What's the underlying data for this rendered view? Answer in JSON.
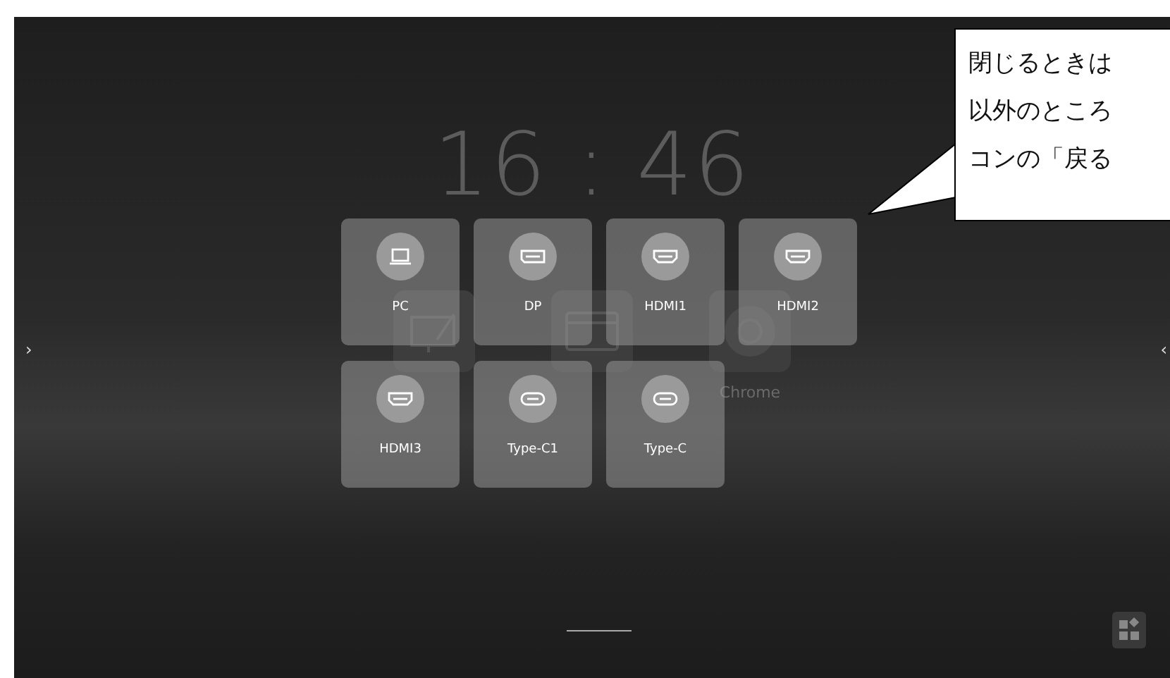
{
  "clock": {
    "time": "16 : 46"
  },
  "apps": [
    {
      "kind": "note"
    },
    {
      "kind": "folder"
    },
    {
      "label": "Chrome",
      "kind": "browser"
    }
  ],
  "side_arrows": {
    "left": "›",
    "right": "‹"
  },
  "input_sources": [
    {
      "label": "PC",
      "kind": "laptop"
    },
    {
      "label": "DP",
      "kind": "dp"
    },
    {
      "label": "HDMI1",
      "kind": "hdmi"
    },
    {
      "label": "HDMI2",
      "kind": "hdmi"
    },
    {
      "label": "HDMI3",
      "kind": "hdmi"
    },
    {
      "label": "Type-C1",
      "kind": "usbc"
    },
    {
      "label": "Type-C",
      "kind": "usbc"
    }
  ],
  "callout": {
    "lines": [
      "閉じるときは",
      "以外のところ",
      "コンの「戻る"
    ]
  }
}
